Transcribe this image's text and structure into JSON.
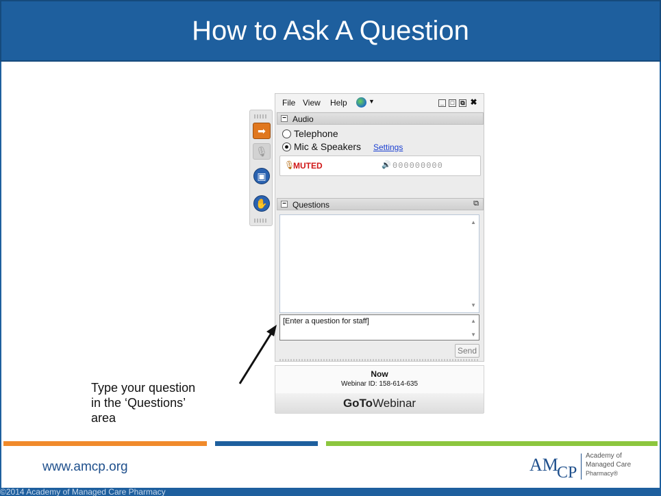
{
  "slide": {
    "title": "How to Ask A Question",
    "callout_lines": [
      "Type your question",
      "in the ‘Questions’",
      "area"
    ],
    "website": "www.amcp.org",
    "copyright": "©2014 Academy of Managed Care Pharmacy",
    "logo": {
      "mark": "AM",
      "mark_sub": "CP",
      "lines": [
        "Academy of",
        "Managed Care",
        "Pharmacy®"
      ]
    },
    "accent_colors": {
      "orange": "#f08a2b",
      "blue": "#1e5f9e",
      "green": "#8cc63e"
    }
  },
  "panel": {
    "menu": {
      "file": "File",
      "view": "View",
      "help": "Help"
    },
    "audio": {
      "header": "Audio",
      "option_telephone": "Telephone",
      "option_mic": "Mic & Speakers",
      "settings_link": "Settings",
      "selected": "Mic & Speakers",
      "muted_label": "MUTED",
      "level_meter": "000000000"
    },
    "questions": {
      "header": "Questions",
      "input_placeholder": "[Enter a question for staff]",
      "send_label": "Send"
    },
    "webinar": {
      "status": "Now",
      "id_label": "Webinar ID: 158-614-635",
      "brand_bold": "GoTo",
      "brand_regular": "Webinar"
    },
    "side_icons": [
      "arrow-right-icon",
      "microphone-icon",
      "screen-icon",
      "raise-hand-icon"
    ]
  }
}
